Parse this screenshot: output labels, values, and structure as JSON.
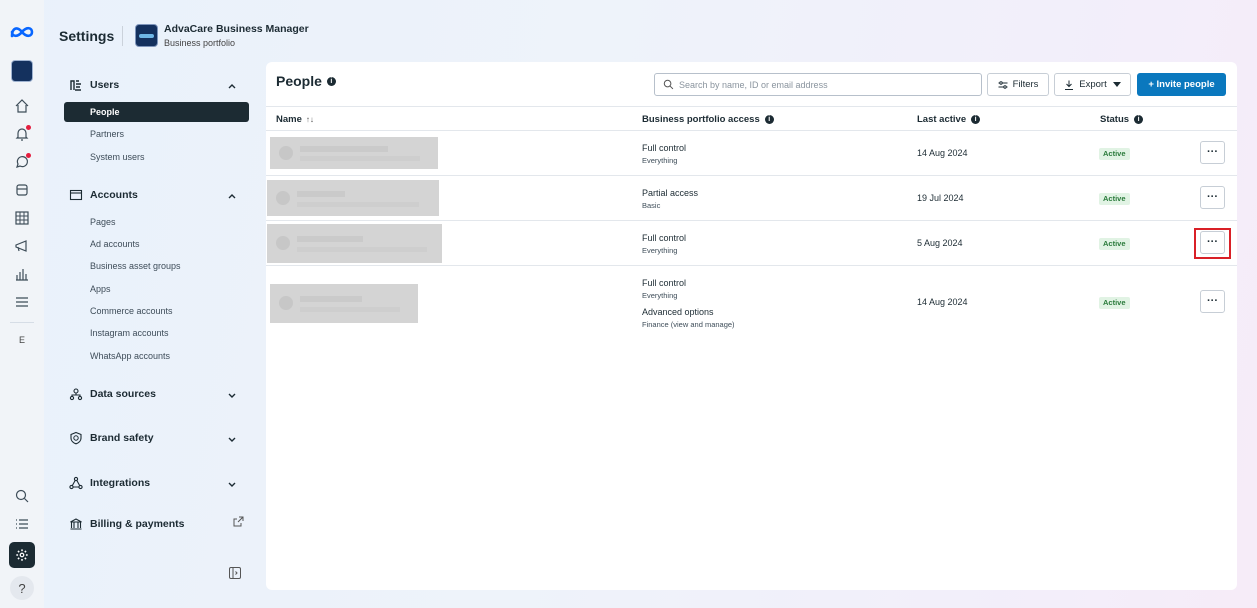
{
  "header": {
    "title": "Settings",
    "portfolio_name": "AdvaCare Business Manager",
    "portfolio_sub": "Business portfolio"
  },
  "rail": {
    "icons": [
      "meta-logo",
      "home-icon",
      "notifications-icon",
      "chat-icon",
      "accounts-icon",
      "table-icon",
      "ads-icon",
      "analytics-icon",
      "menu-icon"
    ],
    "letter": "E",
    "help": "?"
  },
  "sidebar": {
    "users": {
      "label": "Users",
      "items": [
        "People",
        "Partners",
        "System users"
      ]
    },
    "accounts": {
      "label": "Accounts",
      "items": [
        "Pages",
        "Ad accounts",
        "Business asset groups",
        "Apps",
        "Commerce accounts",
        "Instagram accounts",
        "WhatsApp accounts"
      ]
    },
    "data_sources": "Data sources",
    "brand_safety": "Brand safety",
    "integrations": "Integrations",
    "billing": "Billing & payments"
  },
  "main": {
    "title": "People",
    "search_placeholder": "Search by name, ID or email address",
    "filters_label": "Filters",
    "export_label": "Export",
    "invite_label": "+ Invite people",
    "columns": {
      "name": "Name",
      "name_sort": "↑↓",
      "access": "Business portfolio access",
      "last_active": "Last active",
      "status": "Status"
    },
    "rows": [
      {
        "access": "Full control",
        "access_sub": "Everything",
        "last_active": "14 Aug 2024",
        "status": "Active"
      },
      {
        "access": "Partial access",
        "access_sub": "Basic",
        "last_active": "19 Jul 2024",
        "status": "Active"
      },
      {
        "access": "Full control",
        "access_sub": "Everything",
        "last_active": "5 Aug 2024",
        "status": "Active"
      },
      {
        "access": "Full control",
        "access_sub": "Everything",
        "access2": "Advanced options",
        "access2_sub": "Finance (view and manage)",
        "last_active": "14 Aug 2024",
        "status": "Active"
      }
    ],
    "more_label": "···"
  },
  "colors": {
    "primary": "#0a78be",
    "dark": "#1c2b33",
    "active_badge_bg": "#e1f3e4",
    "active_badge_text": "#2a7b3b",
    "highlight": "#d92027"
  }
}
